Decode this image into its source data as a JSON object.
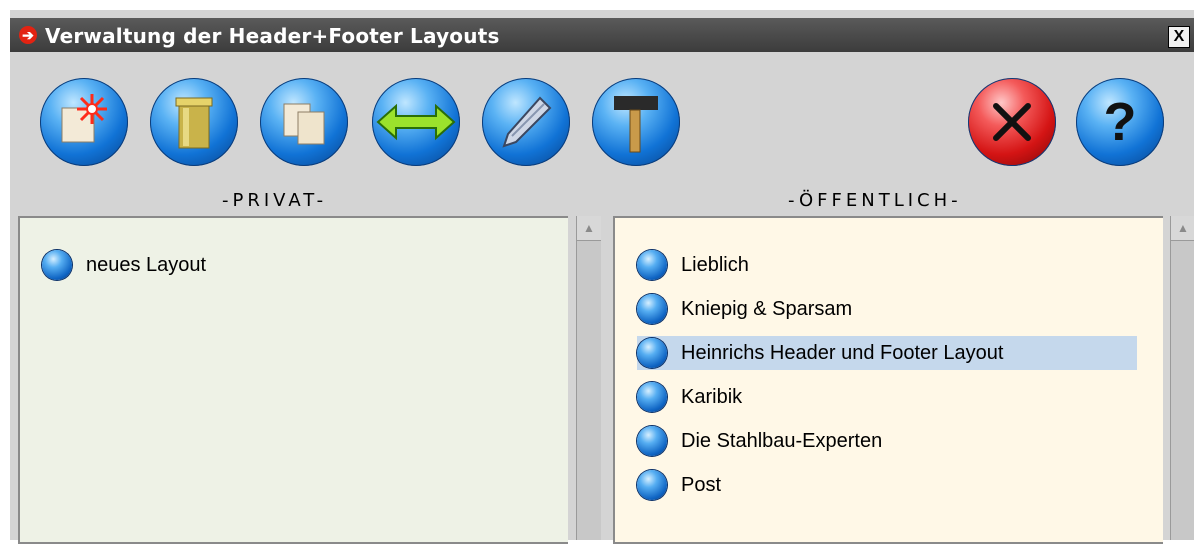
{
  "window": {
    "title": "Verwaltung der Header+Footer Layouts",
    "close_glyph": "X"
  },
  "toolbar": {
    "buttons": [
      {
        "icon": "new-layout-icon"
      },
      {
        "icon": "trash-icon"
      },
      {
        "icon": "copy-icon"
      },
      {
        "icon": "move-icon"
      },
      {
        "icon": "edit-icon"
      },
      {
        "icon": "hammer-icon"
      },
      {
        "icon": "cancel-icon"
      },
      {
        "icon": "help-icon"
      }
    ]
  },
  "private": {
    "label": "-PRIVAT-",
    "items": [
      "neues Layout"
    ]
  },
  "public": {
    "label": "-ÖFFENTLICH-",
    "items": [
      "Lieblich",
      "Kniepig & Sparsam",
      "Heinrichs Header und Footer Layout",
      "Karibik",
      "Die Stahlbau-Experten",
      "Post"
    ],
    "selected": "Heinrichs Header und Footer Layout"
  },
  "colors": {
    "private_panel_bg": "#eef2e6",
    "public_panel_bg": "#fff8e7",
    "selection_bg": "#c5d8ec",
    "window_bg": "#d4d4d4"
  }
}
